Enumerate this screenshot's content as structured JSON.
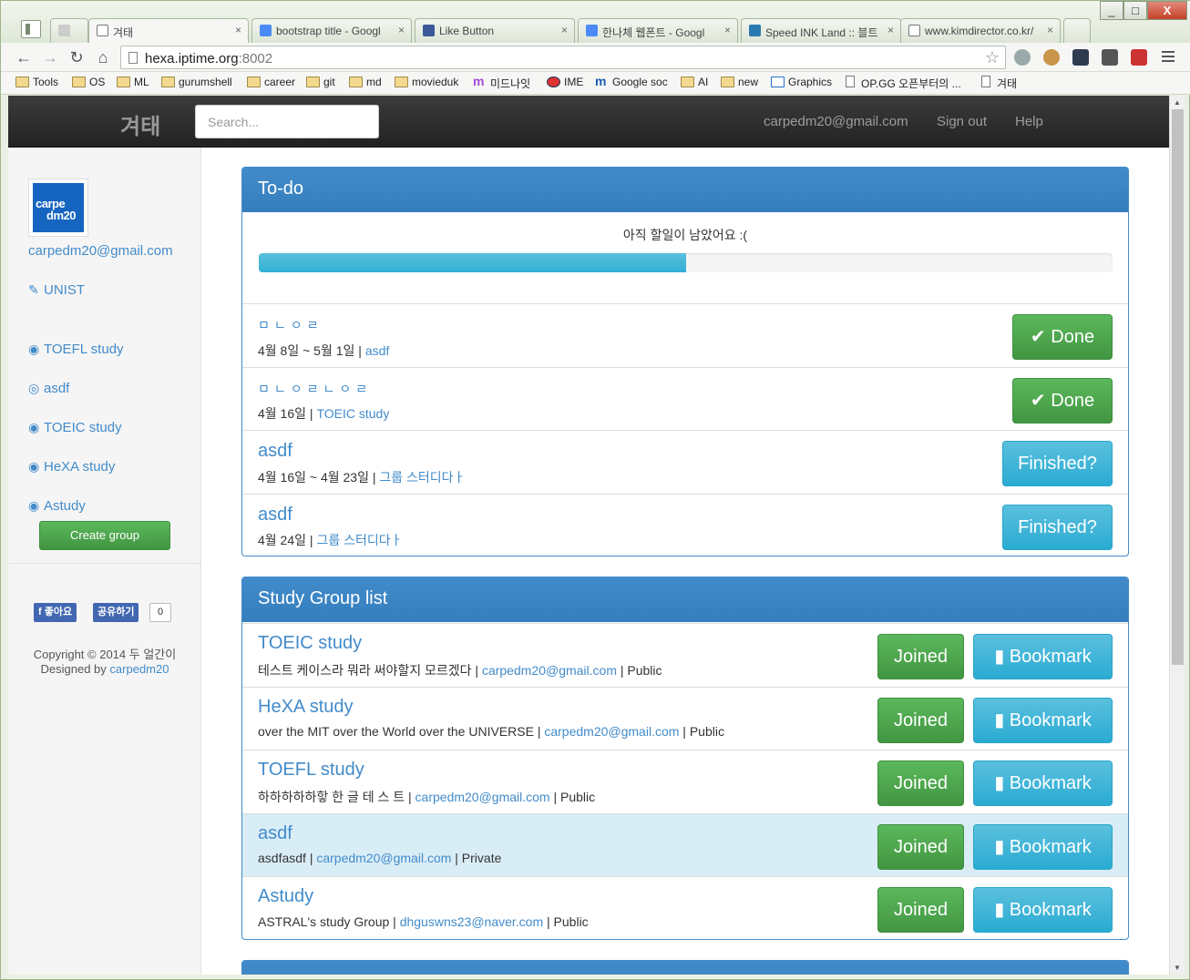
{
  "browser": {
    "tabs": [
      {
        "label": "",
        "favicon_color": "#888888"
      },
      {
        "label": "겨태",
        "favicon_color": "#ffffff"
      },
      {
        "label": "bootstrap title - Googl",
        "favicon_color": "#4c8bf5"
      },
      {
        "label": "Like Button",
        "favicon_color": "#3b5998"
      },
      {
        "label": "한나체 웹폰트 - Googl",
        "favicon_color": "#4c8bf5"
      },
      {
        "label": "Speed INK Land :: 블트",
        "favicon_color": "#2a7ab0"
      },
      {
        "label": "www.kimdirector.co.kr/",
        "favicon_color": "#ffffff"
      }
    ],
    "url_host": "hexa.iptime.org",
    "url_port": ":8002",
    "bookmarks": [
      "Tools",
      "OS",
      "ML",
      "gurumshell",
      "career",
      "git",
      "md",
      "movieduk",
      "미드나잇",
      "IME",
      "Google soc",
      "AI",
      "new",
      "Graphics",
      "OP.GG 오픈부터의 ...",
      "겨태"
    ],
    "close_glyph": "×",
    "win_min": "_",
    "win_max": "□",
    "win_close": "X"
  },
  "navbar": {
    "brand": "겨태",
    "search_placeholder": "Search...",
    "email": "carpedm20@gmail.com",
    "sign_out": "Sign out",
    "help": "Help"
  },
  "sidebar": {
    "avatar_text_1": "carpe",
    "avatar_text_2": "dm20",
    "email": "carpedm20@gmail.com",
    "school": "UNIST",
    "groups": [
      "TOEFL study",
      "asdf",
      "TOEIC study",
      "HeXA study",
      "Astudy"
    ],
    "create_group": "Create group",
    "fb_like": "좋아요",
    "fb_share": "공유하기",
    "fb_count": "0",
    "copyright": "Copyright © 2014 두 얼간이",
    "designed_by": "Designed by",
    "designer": "carpedm20"
  },
  "todo": {
    "title": "To-do",
    "progress_text": "아직 할일이 남았어요 :(",
    "progress_fraction": 0.5,
    "items": [
      {
        "title": "ㅁㄴㅇㄹ",
        "date": "4월 8일 ~ 5월 1일 |",
        "group": "asdf",
        "button": "Done"
      },
      {
        "title": "ㅁㄴㅇㄹㄴㅇㄹ",
        "date": "4월 16일 |",
        "group": "TOEIC study",
        "button": "Done"
      },
      {
        "title": "asdf",
        "date": "4월 16일 ~ 4월 23일 |",
        "group": "그룹 스터디다ㅏ",
        "button": "Finished?"
      },
      {
        "title": "asdf",
        "date": "4월 24일 |",
        "group": "그룹 스터디다ㅏ",
        "button": "Finished?"
      }
    ]
  },
  "groups": {
    "title": "Study Group list",
    "joined_label": "Joined",
    "bookmark_label": "Bookmark",
    "items": [
      {
        "name": "TOEIC study",
        "desc": "테스트 케이스라 뭐라 써야할지 모르겠다 |",
        "owner": "carpedm20@gmail.com",
        "visibility": "| Public"
      },
      {
        "name": "HeXA study",
        "desc": "over the MIT over the World over the UNIVERSE |",
        "owner": "carpedm20@gmail.com",
        "visibility": "| Public"
      },
      {
        "name": "TOEFL study",
        "desc": "하하하하하핳 한 글 테 스 트 |",
        "owner": "carpedm20@gmail.com",
        "visibility": "| Public"
      },
      {
        "name": "asdf",
        "desc": "asdfasdf |",
        "owner": "carpedm20@gmail.com",
        "visibility": "| Private"
      },
      {
        "name": "Astudy",
        "desc": "ASTRAL's study Group |",
        "owner": "dhguswns23@naver.com",
        "visibility": "| Public"
      }
    ]
  }
}
